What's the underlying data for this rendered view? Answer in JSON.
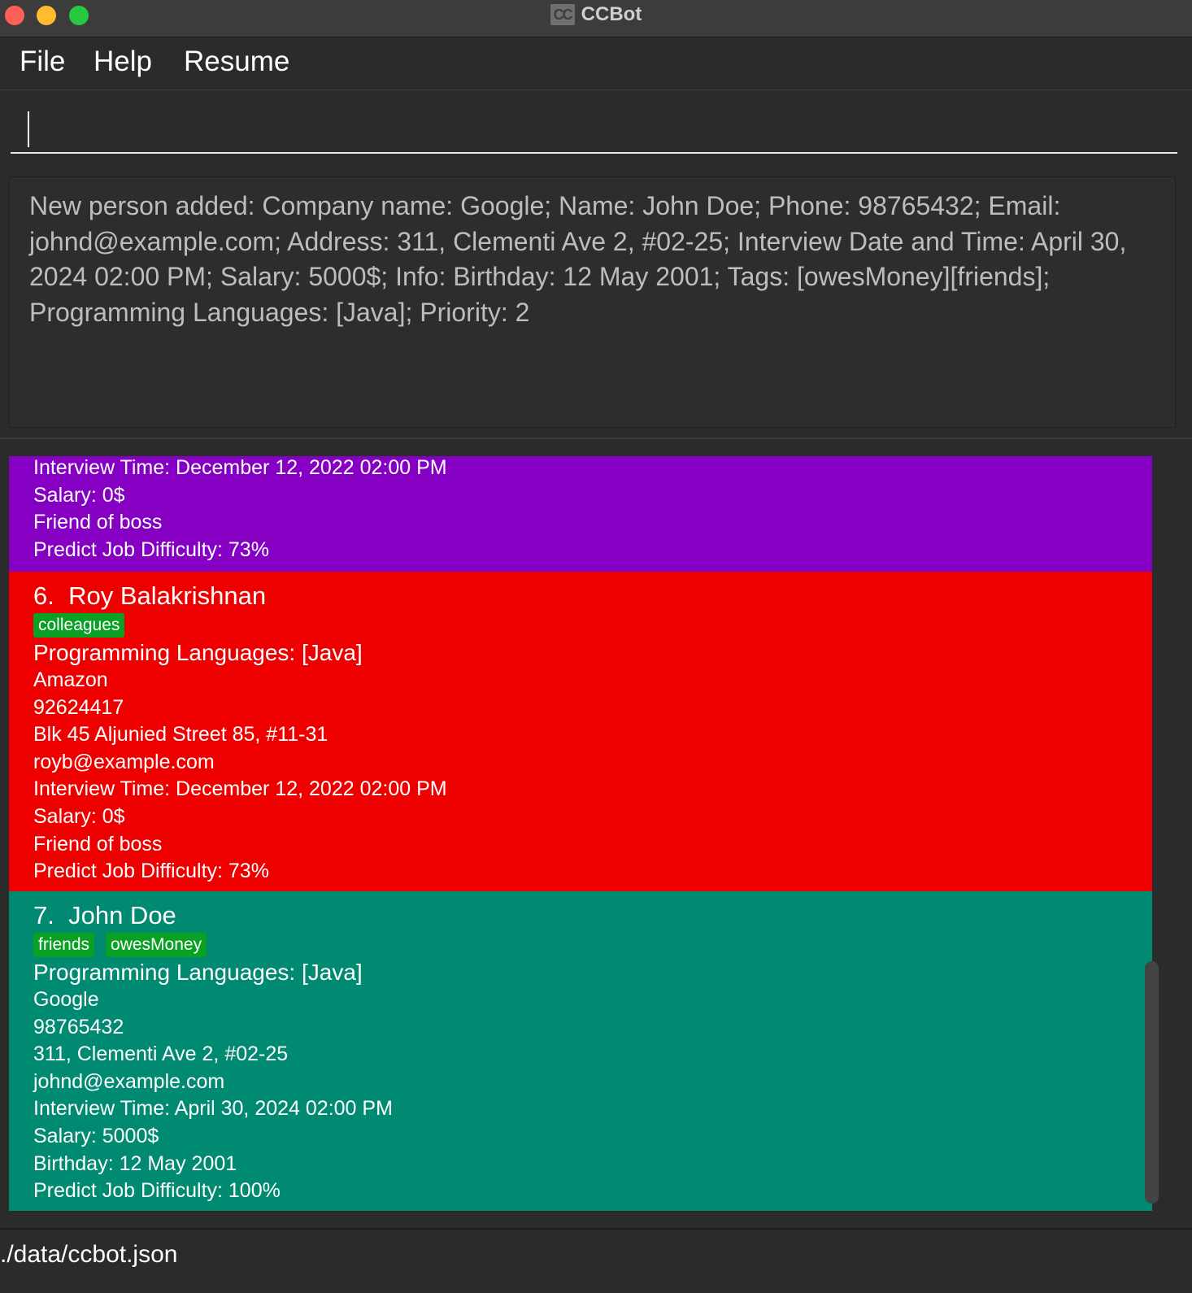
{
  "window": {
    "title": "CCBot",
    "icon_text": "CC"
  },
  "menu": {
    "items": [
      "File",
      "Help",
      "Resume"
    ]
  },
  "command": {
    "value": "",
    "placeholder": ""
  },
  "result": {
    "message": "New person added: Company name: Google; Name: John Doe; Phone: 98765432; Email: johnd@example.com; Address: 311, Clementi Ave 2, #02-25; Interview Date and Time: April 30, 2024 02:00 PM; Salary: 5000$; Info: Birthday: 12 May 2001; Tags: [owesMoney][friends]; Programming Languages: [Java]; Priority: 2"
  },
  "persons": [
    {
      "color": "#8600c4",
      "partial": true,
      "interview": "Interview Time: December 12, 2022 02:00 PM",
      "salary": "Salary: 0$",
      "info": "Friend of boss",
      "difficulty": "Predict Job Difficulty: 73%"
    },
    {
      "color": "#ef0000",
      "index": "6.",
      "name": "Roy Balakrishnan",
      "tags": [
        "colleagues"
      ],
      "languages": "Programming Languages: [Java]",
      "company": "Amazon",
      "phone": "92624417",
      "address": "Blk 45 Aljunied Street 85, #11-31",
      "email": "royb@example.com",
      "interview": "Interview Time: December 12, 2022 02:00 PM",
      "salary": "Salary: 0$",
      "info": "Friend of boss",
      "difficulty": "Predict Job Difficulty: 73%"
    },
    {
      "color": "#008a72",
      "index": "7.",
      "name": "John Doe",
      "tags": [
        "friends",
        "owesMoney"
      ],
      "languages": "Programming Languages: [Java]",
      "company": "Google",
      "phone": "98765432",
      "address": "311, Clementi Ave 2, #02-25",
      "email": "johnd@example.com",
      "interview": "Interview Time: April 30, 2024 02:00 PM",
      "salary": "Salary: 5000$",
      "info": "Birthday: 12 May 2001",
      "difficulty": "Predict Job Difficulty: 100%"
    }
  ],
  "status": {
    "path": "./data/ccbot.json"
  }
}
